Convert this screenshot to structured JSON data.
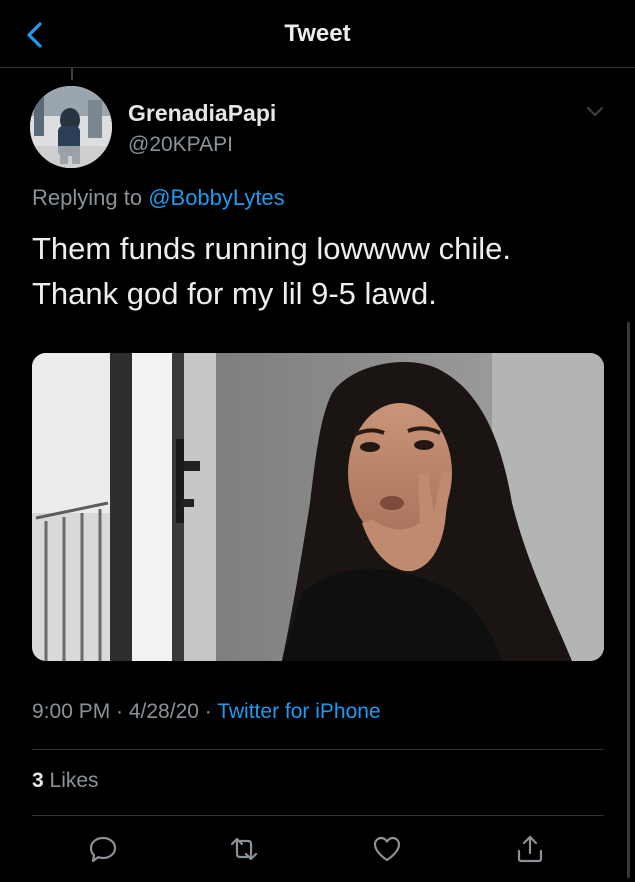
{
  "nav": {
    "title": "Tweet"
  },
  "tweet": {
    "display_name": "GrenadiaPapi",
    "handle": "@20KPAPI",
    "replying_prefix": "Replying to ",
    "replying_to": "@BobbyLytes",
    "text_line1": "Them funds running lowwww chile.",
    "text_line2": "Thank god for my lil 9-5 lawd.",
    "time_date": "9:00 PM · 4/28/20 · ",
    "source": "Twitter for iPhone",
    "likes_count": "3",
    "likes_label": " Likes"
  },
  "actions": {
    "icons": [
      "reply-icon",
      "retweet-icon",
      "like-icon",
      "share-icon"
    ]
  },
  "colors": {
    "background": "#000000",
    "accent": "#1d9bf0",
    "secondary_text": "#8b9298",
    "divider": "#2f3336"
  }
}
